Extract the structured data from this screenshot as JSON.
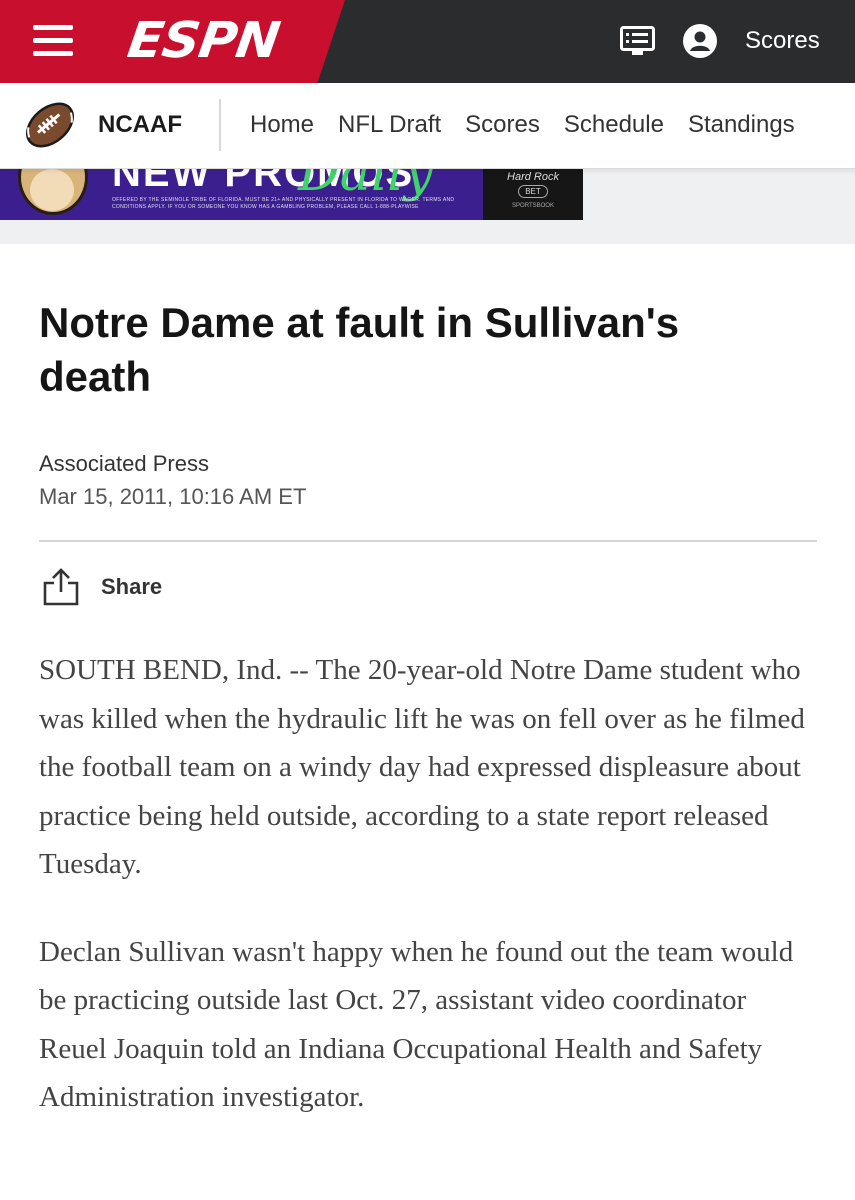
{
  "header": {
    "logo_text": "ESPN",
    "scores_label": "Scores",
    "brand_color": "#c8102e",
    "icons": [
      "menu-icon",
      "news-feed-icon",
      "user-icon"
    ]
  },
  "subnav": {
    "league": "NCAAF",
    "items": [
      {
        "label": "Home"
      },
      {
        "label": "NFL Draft"
      },
      {
        "label": "Scores"
      },
      {
        "label": "Schedule"
      },
      {
        "label": "Standings"
      }
    ]
  },
  "ad": {
    "headline": "NEW PROMOS",
    "script": "Daily",
    "fine_print": "OFFERED BY THE SEMINOLE TRIBE OF FLORIDA. MUST BE 21+ AND PHYSICALLY PRESENT IN FLORIDA TO WAGER. TERMS AND CONDITIONS APPLY. IF YOU OR SOMEONE YOU KNOW HAS A GAMBLING PROBLEM, PLEASE CALL 1-888-PLAYWISE",
    "brand_line1": "Hard Rock",
    "brand_line2": "BET",
    "brand_line3": "SPORTSBOOK"
  },
  "article": {
    "headline": "Notre Dame at fault in Sullivan's death",
    "author": "Associated Press",
    "timestamp": "Mar 15, 2011, 10:16 AM ET",
    "share_label": "Share",
    "paragraphs": [
      "SOUTH BEND, Ind. -- The 20-year-old Notre Dame student who was killed when the hydraulic lift he was on fell over as he filmed the football team on a windy day had expressed displeasure about practice being held outside, according to a state report released Tuesday.",
      "Declan Sullivan wasn't happy when he found out the team would be practicing outside last Oct. 27, assistant video coordinator Reuel Joaquin told an Indiana Occupational Health and Safety Administration investigator."
    ]
  }
}
